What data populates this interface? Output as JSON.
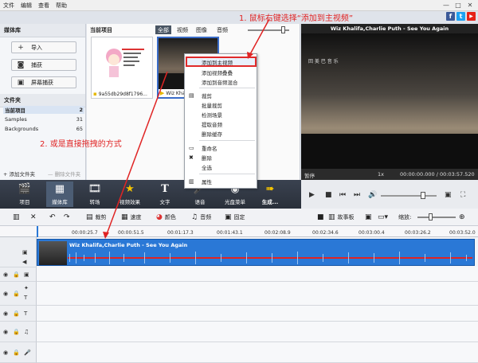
{
  "menubar": {
    "items": [
      "文件",
      "编辑",
      "查看",
      "帮助"
    ]
  },
  "window_controls": {
    "minimize": "—",
    "restore": "□",
    "close": "✕"
  },
  "social": {
    "facebook": "f",
    "twitter": "t",
    "youtube": "▶"
  },
  "media_library": {
    "title": "媒体库",
    "buttons": [
      {
        "label": "导入",
        "icon": "plus-icon"
      },
      {
        "label": "捕获",
        "icon": "camera-icon"
      },
      {
        "label": "屏幕捕获",
        "icon": "screen-capture-icon"
      }
    ],
    "folders_title": "文件夹",
    "folders": [
      {
        "name": "当前项目",
        "count": "2"
      },
      {
        "name": "Samples",
        "count": "31"
      },
      {
        "name": "Backgrounds",
        "count": "65"
      }
    ],
    "add_folder": "+ 添加文件夹",
    "delete_folder": "— 删除文件夹"
  },
  "project": {
    "title": "当前项目",
    "filters": [
      "全部",
      "视频",
      "图像",
      "音频"
    ],
    "thumbnails": [
      {
        "label": "9a55db29d8f1796..."
      },
      {
        "label": "Wiz Khalif..."
      }
    ]
  },
  "context_menu": {
    "items": [
      "添加到主视频",
      "添加视频叠叠",
      "添加到音频混合",
      "裁剪",
      "批量裁剪",
      "检测场景",
      "提取音频",
      "删除缓存",
      "重命名",
      "删除",
      "全选",
      "属性"
    ]
  },
  "preview": {
    "title": "Wiz Khalifa,Charlie Puth - See You Again",
    "watermark": "回 美 巴 音 乐",
    "status": "暂停",
    "speed": "1x",
    "time": "00:00:00.000 / 00:03:57.520"
  },
  "ribbon": {
    "items": [
      "项目",
      "媒体库",
      "转场",
      "视频效果",
      "文字",
      "语音",
      "光盘菜单",
      "生成..."
    ]
  },
  "timeline_toolbar": {
    "crop": "裁剪",
    "speed": "速度",
    "color": "颜色",
    "audio": "音频",
    "freeze": "固定",
    "storyboard": "故事板",
    "zoom": "缩放:"
  },
  "ruler": {
    "ticks": [
      "00:00:25.7",
      "00:00:51.5",
      "00:01:17.3",
      "00:01:43.1",
      "00:02:08.9",
      "00:02:34.6",
      "00:03:00.4",
      "00:03:26.2",
      "00:03:52.0"
    ]
  },
  "clip": {
    "title": "Wiz Khalifa,Charlie Puth - See You Again"
  },
  "annotations": {
    "note1": "1. 鼠标右键选择“添加到主视频”",
    "note2": "2. 或是直接拖拽的方式"
  },
  "colors": {
    "accent_red": "#e02424",
    "clip_blue": "#2a78d6",
    "ribbon_dark": "#2a303a"
  }
}
